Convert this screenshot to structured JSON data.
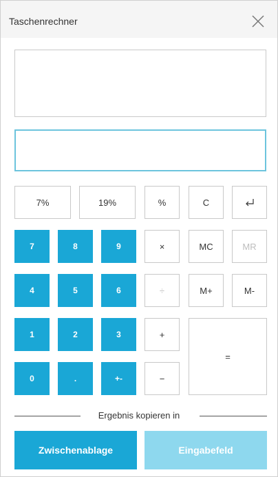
{
  "window": {
    "title": "Taschenrechner"
  },
  "icons": {
    "close": "close-icon",
    "enter": "enter-return-icon"
  },
  "colors": {
    "accent": "#1aa7d6",
    "accent_light": "#8ed8ee",
    "border": "#c8c8c8",
    "focus_border": "#6cc4dd"
  },
  "display": {
    "expression": "",
    "input": ""
  },
  "percent_buttons": {
    "seven": "7%",
    "nineteen": "19%"
  },
  "keys": {
    "percent": "%",
    "clear": "C",
    "enter": "↵",
    "multiply": "×",
    "divide": "÷",
    "plus": "+",
    "minus": "−",
    "equals": "=",
    "mc": "MC",
    "mr": "MR",
    "mplus": "M+",
    "mminus": "M-",
    "d7": "7",
    "d8": "8",
    "d9": "9",
    "d4": "4",
    "d5": "5",
    "d6": "6",
    "d1": "1",
    "d2": "2",
    "d3": "3",
    "d0": "0",
    "decimal": ".",
    "sign": "+-"
  },
  "copy": {
    "label": "Ergebnis kopieren in",
    "clipboard": "Zwischenablage",
    "inputfield": "Eingabefeld"
  }
}
